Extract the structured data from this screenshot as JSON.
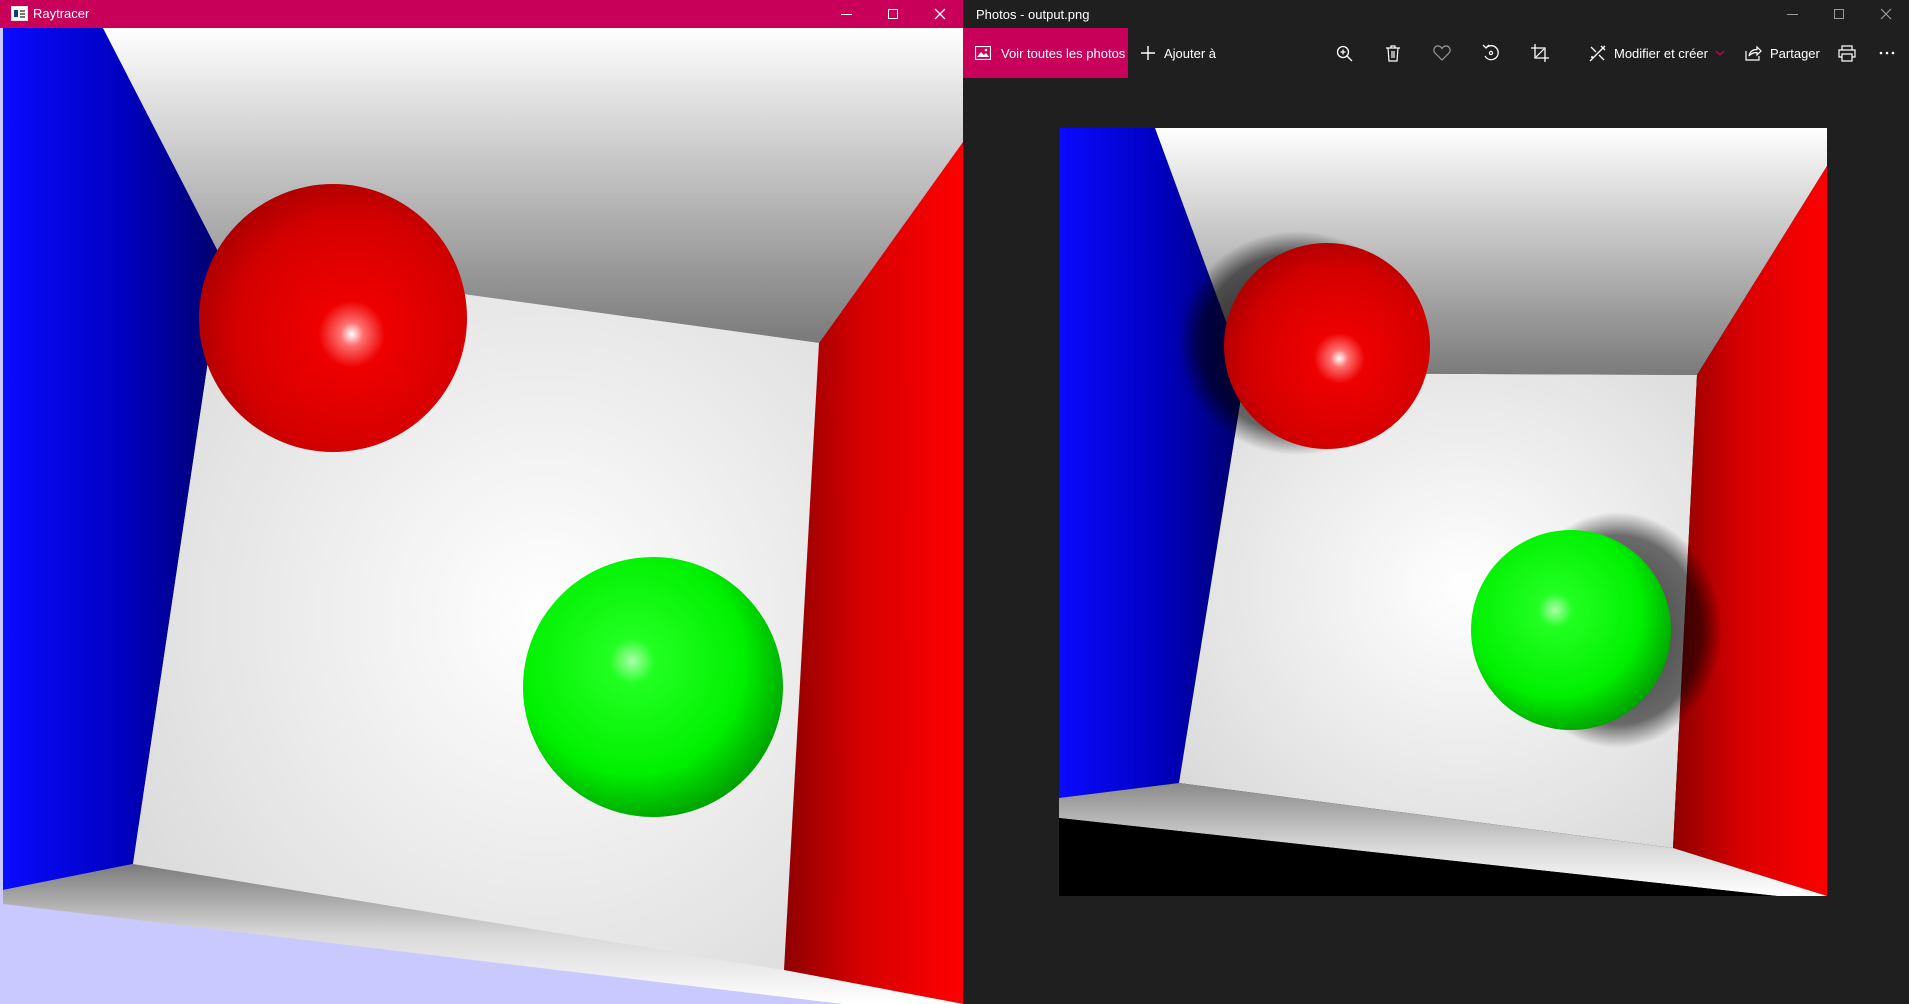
{
  "raytracer": {
    "title": "Raytracer"
  },
  "photos": {
    "title": "Photos - output.png",
    "toolbar": {
      "all_photos": "Voir toutes les photos",
      "add_to": "Ajouter à",
      "edit_create": "Modifier et créer",
      "share": "Partager"
    },
    "icons": [
      "photo-gallery-icon",
      "plus-icon",
      "zoom-in-icon",
      "delete-icon",
      "heart-icon",
      "rotate-icon",
      "crop-icon",
      "edit-create-icon",
      "chevron-down-icon",
      "share-icon",
      "print-icon",
      "more-icon"
    ]
  },
  "colors": {
    "accent": "#c8005a",
    "photos_background": "#1f1f1f",
    "wall_left": "#0000ff",
    "wall_right": "#ff0000",
    "sphere_1": "#ff0000",
    "sphere_2": "#00ff00",
    "walls_back": "#ffffff"
  }
}
